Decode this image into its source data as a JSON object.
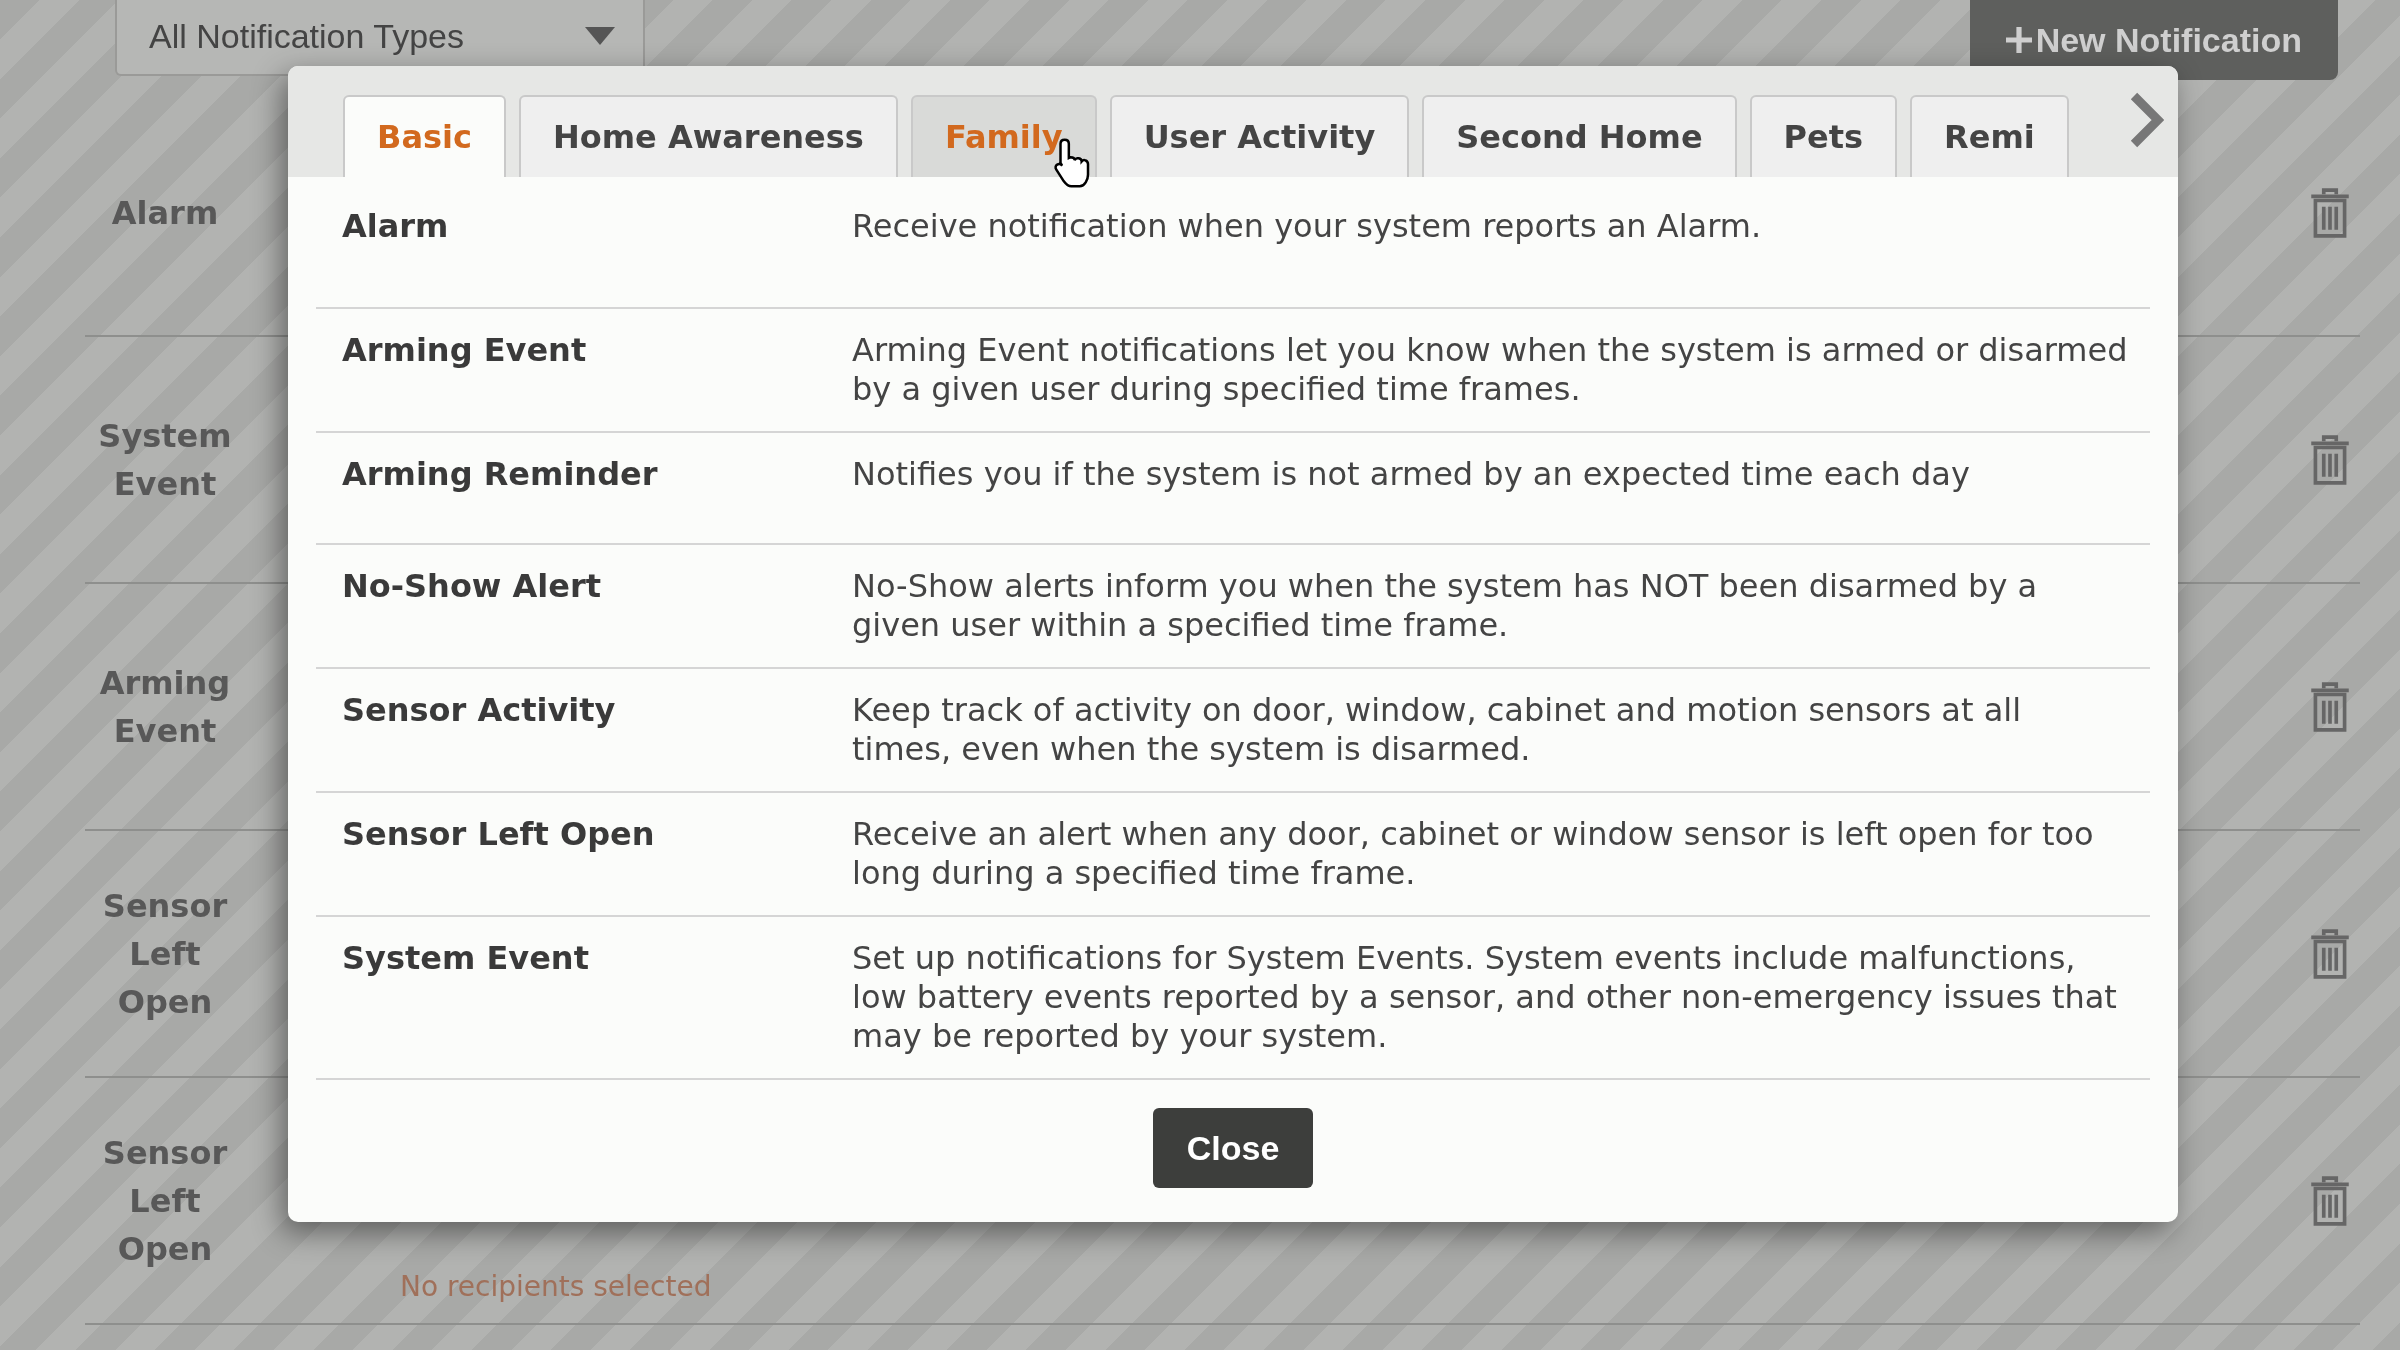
{
  "filter": {
    "value": "All Notification Types"
  },
  "new_button": {
    "label": "New Notification"
  },
  "rows": [
    {
      "label": "Alarm"
    },
    {
      "label": "System Event"
    },
    {
      "label": "Arming Event"
    },
    {
      "label": "Sensor Left Open"
    },
    {
      "label": "Sensor Left Open",
      "recipients": "No recipients selected"
    }
  ],
  "dialog": {
    "tabs": [
      {
        "label": "Basic",
        "selected": true,
        "hovered": false
      },
      {
        "label": "Home Awareness",
        "selected": false,
        "hovered": false
      },
      {
        "label": "Family",
        "selected": false,
        "hovered": true
      },
      {
        "label": "User Activity",
        "selected": false,
        "hovered": false
      },
      {
        "label": "Second Home",
        "selected": false,
        "hovered": false
      },
      {
        "label": "Pets",
        "selected": false,
        "hovered": false
      },
      {
        "label": "Remi",
        "selected": false,
        "hovered": false
      }
    ],
    "notifications": [
      {
        "name": "Alarm",
        "description": "Receive notification when your system reports an Alarm."
      },
      {
        "name": "Arming Event",
        "description": "Arming Event notifications let you know when the system is armed or disarmed by a given user during specified time frames."
      },
      {
        "name": "Arming Reminder",
        "description": "Notifies you if the system is not armed by an expected time each day"
      },
      {
        "name": "No-Show Alert",
        "description": "No-Show alerts inform you when the system has NOT been disarmed by a given user within a specified time frame."
      },
      {
        "name": "Sensor Activity",
        "description": "Keep track of activity on door, window, cabinet and motion sensors at all times, even when the system is disarmed."
      },
      {
        "name": "Sensor Left Open",
        "description": "Receive an alert when any door, cabinet or window sensor is left open for too long during a specified time frame."
      },
      {
        "name": "System Event",
        "description": "Set up notifications for System Events. System events include malfunctions, low battery events reported by a sensor, and other non-emergency issues that may be reported by your system."
      }
    ],
    "close_button": "Close"
  }
}
